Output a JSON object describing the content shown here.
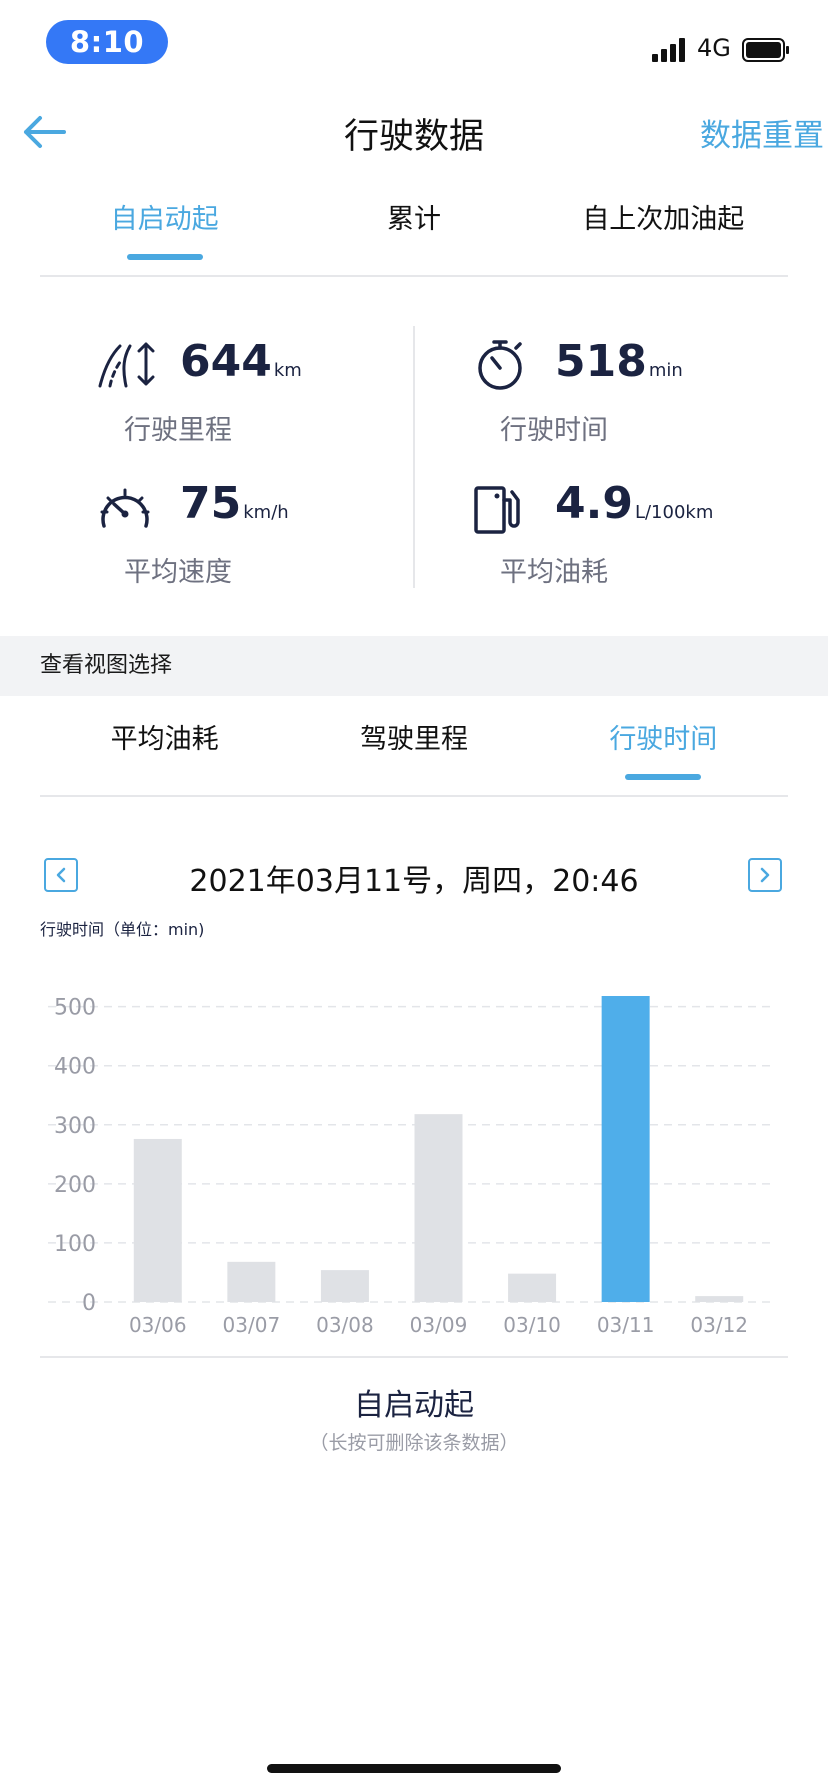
{
  "status_bar": {
    "time": "8:10",
    "network": "4G"
  },
  "header": {
    "title": "行驶数据",
    "reset_label": "数据重置"
  },
  "tabs": [
    {
      "label": "自启动起",
      "active": true
    },
    {
      "label": "累计",
      "active": false
    },
    {
      "label": "自上次加油起",
      "active": false
    }
  ],
  "stats": {
    "mileage": {
      "value": "644",
      "unit": "km",
      "label": "行驶里程"
    },
    "drive_time": {
      "value": "518",
      "unit": "min",
      "label": "行驶时间"
    },
    "avg_speed": {
      "value": "75",
      "unit": "km/h",
      "label": "平均速度"
    },
    "avg_fuel": {
      "value": "4.9",
      "unit": "L/100km",
      "label": "平均油耗"
    }
  },
  "view_section": {
    "title": "查看视图选择"
  },
  "view_tabs": [
    {
      "label": "平均油耗",
      "active": false
    },
    {
      "label": "驾驶里程",
      "active": false
    },
    {
      "label": "行驶时间",
      "active": true
    }
  ],
  "date_nav": {
    "date_text": "2021年03月11号，周四，20:46"
  },
  "chart_unit_label": "行驶时间（单位：min)",
  "chart_data": {
    "type": "bar",
    "categories": [
      "03/06",
      "03/07",
      "03/08",
      "03/09",
      "03/10",
      "03/11",
      "03/12"
    ],
    "values": [
      276,
      68,
      54,
      318,
      48,
      518,
      10
    ],
    "highlight_index": 5,
    "yticks": [
      0,
      100,
      200,
      300,
      400,
      500
    ],
    "ylim": [
      0,
      518
    ],
    "colors": {
      "bar": "#dfe1e5",
      "highlight": "#4faeea",
      "tick": "#9a9ca6",
      "grid": "#e3e5e9"
    }
  },
  "caption": {
    "title": "自启动起",
    "hint": "（长按可删除该条数据）"
  },
  "colors": {
    "accent": "#4aa8e0",
    "status_pill": "#3478f6",
    "dark_text": "#1b2341"
  }
}
